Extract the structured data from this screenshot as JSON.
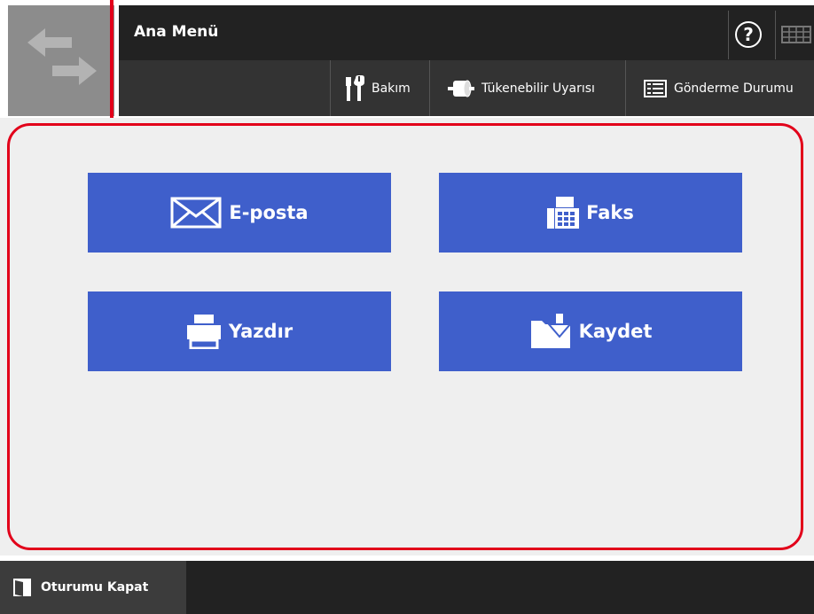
{
  "header": {
    "title": "Ana Menü",
    "help_glyph": "?",
    "logo_icon": "swap-arrows-icon",
    "keyboard_icon": "keyboard-icon"
  },
  "toolbar": {
    "items": [
      {
        "label": "Bakım",
        "icon": "maintenance-tools-icon"
      },
      {
        "label": "Tükenebilir Uyarısı",
        "icon": "consumable-roll-icon"
      },
      {
        "label": "Gönderme Durumu",
        "icon": "send-status-list-icon"
      }
    ]
  },
  "main": {
    "actions": [
      {
        "label": "E-posta",
        "icon": "envelope-icon"
      },
      {
        "label": "Faks",
        "icon": "fax-icon"
      },
      {
        "label": "Yazdır",
        "icon": "printer-icon"
      },
      {
        "label": "Kaydet",
        "icon": "folder-save-icon"
      }
    ]
  },
  "footer": {
    "logout_label": "Oturumu Kapat",
    "logout_icon": "logout-door-icon"
  },
  "colors": {
    "action_button": "#3f5fcb",
    "header_bg": "#222222",
    "toolbar_bg": "#333333",
    "content_bg": "#efefef",
    "highlight_frame": "#e2001a",
    "logo_tile": "#8c8c8c"
  }
}
